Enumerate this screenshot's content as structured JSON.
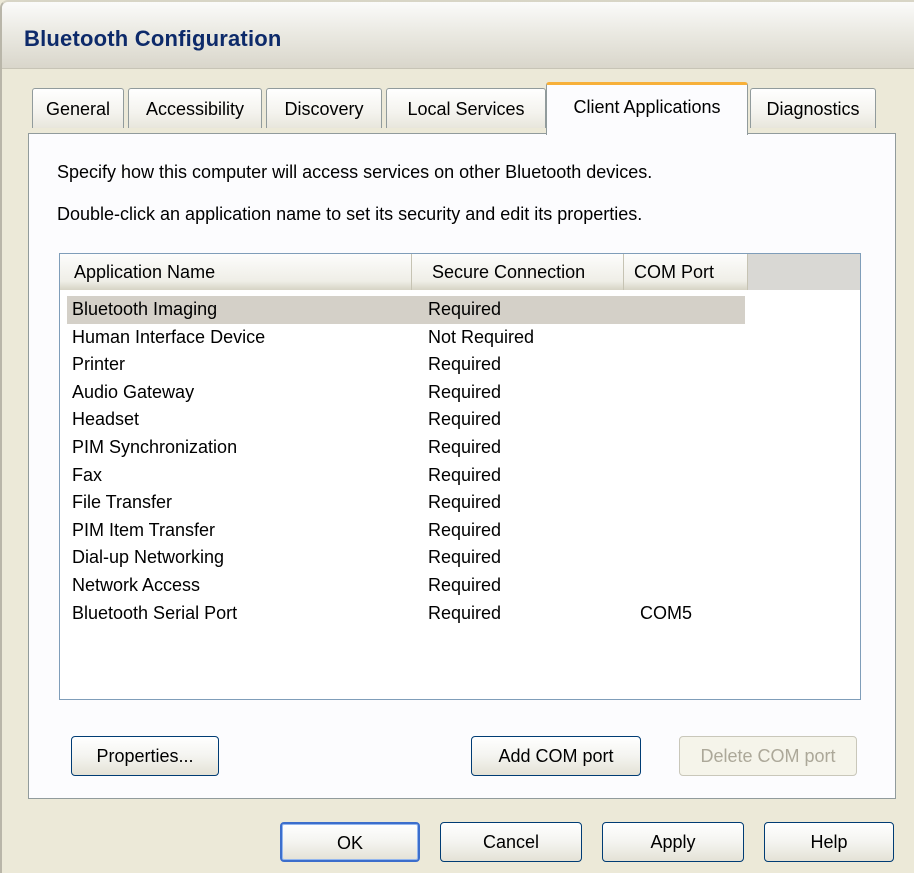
{
  "window": {
    "title": "Bluetooth Configuration"
  },
  "tabs": [
    {
      "label": "General",
      "active": false
    },
    {
      "label": "Accessibility",
      "active": false
    },
    {
      "label": "Discovery",
      "active": false
    },
    {
      "label": "Local Services",
      "active": false
    },
    {
      "label": "Client Applications",
      "active": true
    },
    {
      "label": "Diagnostics",
      "active": false
    }
  ],
  "panel": {
    "description_line1": "Specify how this computer will access services on other Bluetooth devices.",
    "description_line2": "Double-click an application name to set its security and edit its properties.",
    "columns": {
      "app_name": "Application Name",
      "secure": "Secure Connection",
      "com_port": "COM Port"
    },
    "rows": [
      {
        "name": "Bluetooth Imaging",
        "secure": "Required",
        "com": "",
        "selected": true
      },
      {
        "name": "Human Interface Device",
        "secure": "Not Required",
        "com": ""
      },
      {
        "name": "Printer",
        "secure": "Required",
        "com": ""
      },
      {
        "name": "Audio Gateway",
        "secure": "Required",
        "com": ""
      },
      {
        "name": "Headset",
        "secure": "Required",
        "com": ""
      },
      {
        "name": "PIM Synchronization",
        "secure": "Required",
        "com": ""
      },
      {
        "name": "Fax",
        "secure": "Required",
        "com": ""
      },
      {
        "name": "File Transfer",
        "secure": "Required",
        "com": ""
      },
      {
        "name": "PIM Item Transfer",
        "secure": "Required",
        "com": ""
      },
      {
        "name": "Dial-up Networking",
        "secure": "Required",
        "com": ""
      },
      {
        "name": "Network Access",
        "secure": "Required",
        "com": ""
      },
      {
        "name": "Bluetooth Serial Port",
        "secure": "Required",
        "com": "COM5"
      }
    ],
    "buttons": {
      "properties": "Properties...",
      "add_com": "Add COM port",
      "delete_com": "Delete COM port"
    }
  },
  "footer": {
    "ok": "OK",
    "cancel": "Cancel",
    "apply": "Apply",
    "help": "Help"
  }
}
